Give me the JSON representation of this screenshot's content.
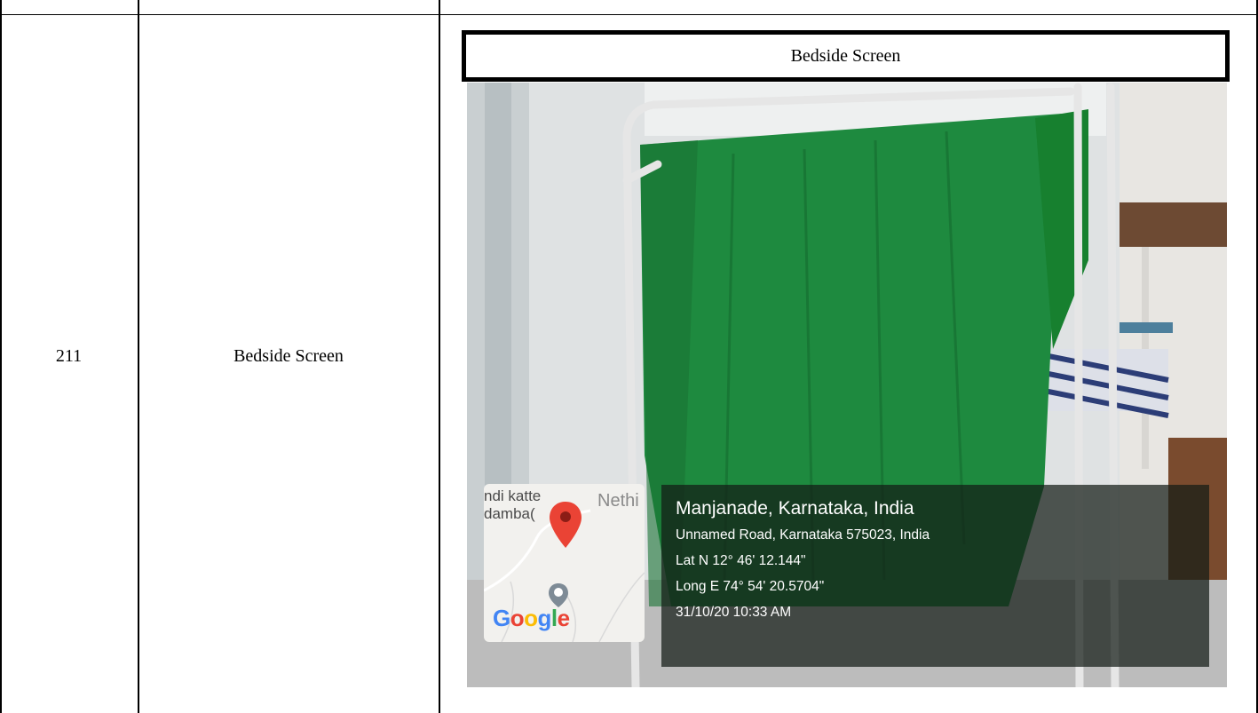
{
  "row": {
    "serial_number": "211",
    "item_name": "Bedside Screen",
    "photo_caption": "Bedside Screen"
  },
  "geotag": {
    "place": "Manjanade, Karnataka, India",
    "address": "Unnamed Road, Karnataka 575023, India",
    "latitude": "Lat N 12° 46' 12.144\"",
    "longitude": "Long E 74° 54' 20.5704\"",
    "timestamp": "31/10/20 10:33 AM"
  },
  "map_thumbnail": {
    "label_1": "ndi katte",
    "label_2": "damba(",
    "label_3": "Nethi",
    "logo_text": "Google",
    "logo_colors": [
      "#4285F4",
      "#EA4335",
      "#FBBC05",
      "#4285F4",
      "#34A853",
      "#EA4335"
    ],
    "pin_color": "#EA4335"
  },
  "colors": {
    "curtain_green": "#1e8a3f",
    "frame_white": "#e6e6e6"
  }
}
